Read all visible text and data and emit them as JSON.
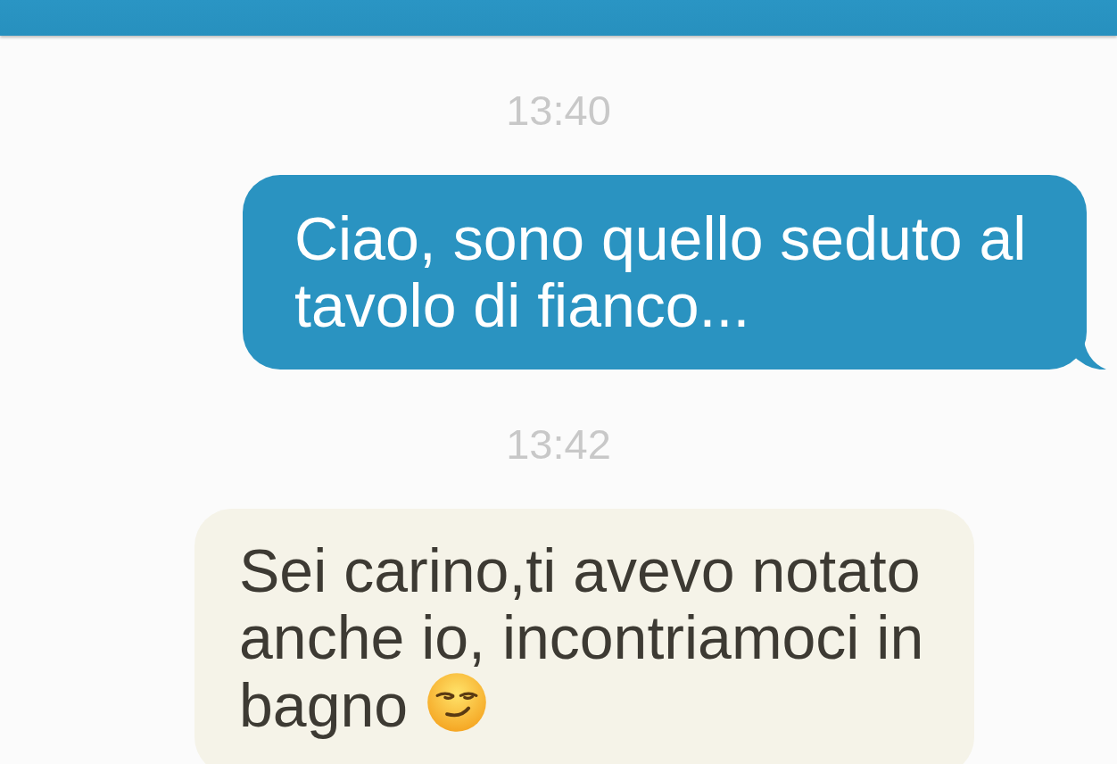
{
  "messages": [
    {
      "kind": "time",
      "text": "13:40"
    },
    {
      "kind": "sent",
      "text": "Ciao, sono quello seduto al tavolo di fianco...",
      "emoji": false
    },
    {
      "kind": "time",
      "text": "13:42"
    },
    {
      "kind": "received",
      "text": "Sei carino,ti avevo notato anche io, incontriamoci in bagno",
      "emoji": true
    }
  ]
}
